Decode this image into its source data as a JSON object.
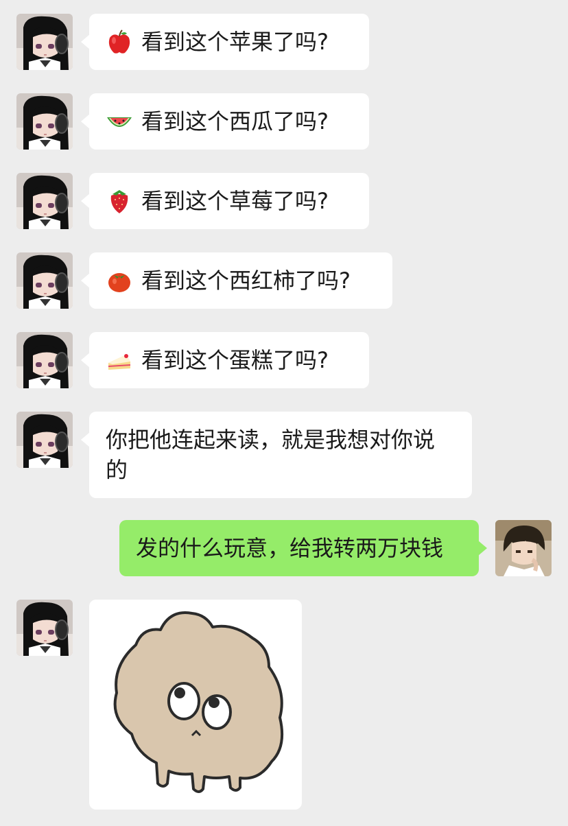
{
  "messages": [
    {
      "side": "left",
      "emoji": "apple-icon",
      "text": "看到这个苹果了吗?"
    },
    {
      "side": "left",
      "emoji": "watermelon-icon",
      "text": "看到这个西瓜了吗?"
    },
    {
      "side": "left",
      "emoji": "strawberry-icon",
      "text": "看到这个草莓了吗?"
    },
    {
      "side": "left",
      "emoji": "tomato-icon",
      "text": "看到这个西红柿了吗?"
    },
    {
      "side": "left",
      "emoji": "cake-icon",
      "text": "看到这个蛋糕了吗?"
    },
    {
      "side": "left",
      "text_line1": "你把他连起来读，就是我想对你说",
      "text_line2": "的"
    },
    {
      "side": "right",
      "text": "发的什么玩意，给我转两万块钱"
    },
    {
      "side": "left",
      "sticker": "bear-sticker"
    }
  ],
  "colors": {
    "background": "#ededed",
    "incoming_bubble": "#ffffff",
    "outgoing_bubble": "#95ec69"
  }
}
